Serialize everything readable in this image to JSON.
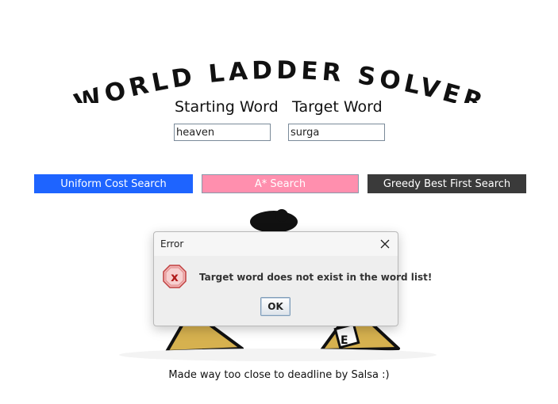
{
  "app": {
    "title": "WORLD LADDER SOLVER"
  },
  "form": {
    "start_label": "Starting Word",
    "start_value": "heaven",
    "target_label": "Target Word",
    "target_value": "surga"
  },
  "buttons": {
    "ucs": {
      "label": "Uniform Cost Search",
      "color": "#1e64ff"
    },
    "astar": {
      "label": "A* Search",
      "color": "#ff8fae"
    },
    "gbfs": {
      "label": "Greedy Best First Search",
      "color": "#3a3a3a"
    }
  },
  "footer": {
    "credit": "Made way too close to deadline by Salsa :)"
  },
  "dialog": {
    "title": "Error",
    "message": "Target word does not exist in the word list!",
    "ok_label": "OK",
    "icon": "error-x-icon"
  }
}
